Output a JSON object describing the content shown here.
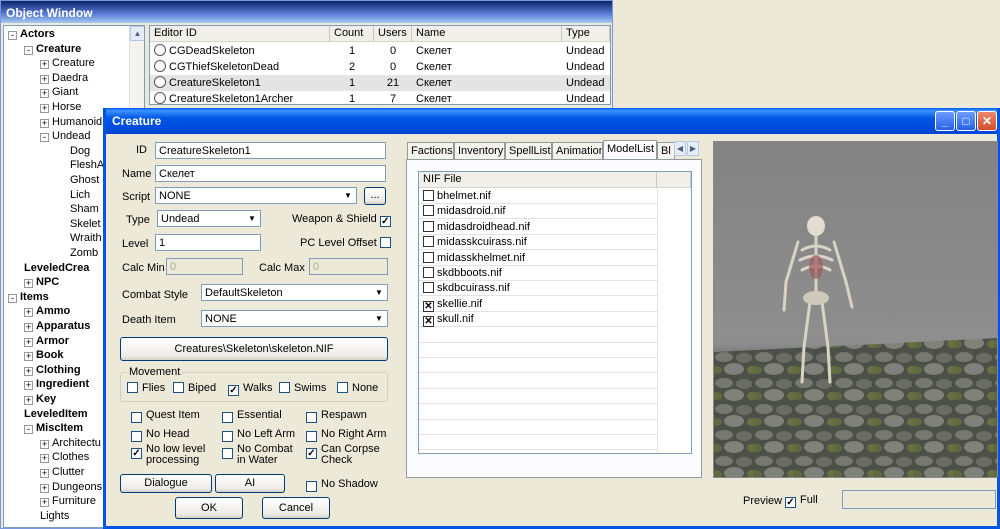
{
  "object_window": {
    "title": "Object Window",
    "tree": [
      {
        "label": "Actors",
        "level": 0,
        "bold": true,
        "box": "-"
      },
      {
        "label": "Creature",
        "level": 1,
        "bold": true,
        "box": "-"
      },
      {
        "label": "Creature",
        "level": 2,
        "bold": false,
        "box": "+"
      },
      {
        "label": "Daedra",
        "level": 2,
        "bold": false,
        "box": "+"
      },
      {
        "label": "Giant",
        "level": 2,
        "bold": false,
        "box": "+"
      },
      {
        "label": "Horse",
        "level": 2,
        "bold": false,
        "box": "+"
      },
      {
        "label": "Humanoid",
        "level": 2,
        "bold": false,
        "box": "+"
      },
      {
        "label": "Undead",
        "level": 2,
        "bold": false,
        "box": "-"
      },
      {
        "label": "Dog",
        "level": 3,
        "bold": false,
        "box": ""
      },
      {
        "label": "FleshA",
        "level": 3,
        "bold": false,
        "box": ""
      },
      {
        "label": "Ghost",
        "level": 3,
        "bold": false,
        "box": ""
      },
      {
        "label": "Lich",
        "level": 3,
        "bold": false,
        "box": ""
      },
      {
        "label": "Sham",
        "level": 3,
        "bold": false,
        "box": ""
      },
      {
        "label": "Skelet",
        "level": 3,
        "bold": false,
        "box": ""
      },
      {
        "label": "Wraith",
        "level": 3,
        "bold": false,
        "box": ""
      },
      {
        "label": "Zomb",
        "level": 3,
        "bold": false,
        "box": ""
      },
      {
        "label": "LeveledCrea",
        "level": 1,
        "bold": true,
        "box": ""
      },
      {
        "label": "NPC",
        "level": 1,
        "bold": true,
        "box": "+"
      },
      {
        "label": "Items",
        "level": 0,
        "bold": true,
        "box": "-"
      },
      {
        "label": "Ammo",
        "level": 1,
        "bold": true,
        "box": "+"
      },
      {
        "label": "Apparatus",
        "level": 1,
        "bold": true,
        "box": "+"
      },
      {
        "label": "Armor",
        "level": 1,
        "bold": true,
        "box": "+"
      },
      {
        "label": "Book",
        "level": 1,
        "bold": true,
        "box": "+"
      },
      {
        "label": "Clothing",
        "level": 1,
        "bold": true,
        "box": "+"
      },
      {
        "label": "Ingredient",
        "level": 1,
        "bold": true,
        "box": "+"
      },
      {
        "label": "Key",
        "level": 1,
        "bold": true,
        "box": "+"
      },
      {
        "label": "LeveledItem",
        "level": 1,
        "bold": true,
        "box": ""
      },
      {
        "label": "MiscItem",
        "level": 1,
        "bold": true,
        "box": "-"
      },
      {
        "label": "Architectu",
        "level": 2,
        "bold": false,
        "box": "+"
      },
      {
        "label": "Clothes",
        "level": 2,
        "bold": false,
        "box": "+"
      },
      {
        "label": "Clutter",
        "level": 2,
        "bold": false,
        "box": "+"
      },
      {
        "label": "Dungeons",
        "level": 2,
        "bold": false,
        "box": "+"
      },
      {
        "label": "Furniture",
        "level": 2,
        "bold": false,
        "box": "+"
      },
      {
        "label": "Lights",
        "level": 2,
        "bold": false,
        "box": ""
      }
    ],
    "columns": [
      "Editor ID",
      "Count",
      "Users",
      "Name",
      "Type"
    ],
    "rows": [
      {
        "id": "CGDeadSkeleton",
        "count": "1",
        "users": "0",
        "name": "Скелет",
        "type": "Undead"
      },
      {
        "id": "CGThiefSkeletonDead",
        "count": "2",
        "users": "0",
        "name": "Скелет",
        "type": "Undead"
      },
      {
        "id": "CreatureSkeleton1",
        "count": "1",
        "users": "21",
        "name": "Скелет",
        "type": "Undead"
      },
      {
        "id": "CreatureSkeleton1Archer",
        "count": "1",
        "users": "7",
        "name": "Скелет",
        "type": "Undead"
      }
    ]
  },
  "dialog": {
    "title": "Creature",
    "labels": {
      "id": "ID",
      "name": "Name",
      "script": "Script",
      "type": "Type",
      "level": "Level",
      "calc_min": "Calc Min",
      "calc_max": "Calc Max",
      "combat_style": "Combat Style",
      "death_item": "Death Item",
      "weapon_shield": "Weapon & Shield",
      "pc_level_offset": "PC Level Offset",
      "movement": "Movement",
      "preview": "Preview",
      "full": "Full"
    },
    "fields": {
      "id": "CreatureSkeleton1",
      "name": "Скелет",
      "script": "NONE",
      "script_btn": "...",
      "type": "Undead",
      "level": "1",
      "calc_min": "0",
      "calc_max": "0",
      "combat_style": "DefaultSkeleton",
      "death_item": "NONE"
    },
    "model_button": "Creatures\\Skeleton\\skeleton.NIF",
    "movement": [
      {
        "label": "Flies",
        "checked": false
      },
      {
        "label": "Biped",
        "checked": false
      },
      {
        "label": "Walks",
        "checked": true
      },
      {
        "label": "Swims",
        "checked": false
      },
      {
        "label": "None",
        "checked": false
      }
    ],
    "flags": [
      {
        "label": "Quest Item",
        "checked": false
      },
      {
        "label": "Essential",
        "checked": false
      },
      {
        "label": "Respawn",
        "checked": false
      },
      {
        "label": "No Head",
        "checked": false
      },
      {
        "label": "No Left Arm",
        "checked": false
      },
      {
        "label": "No Right Arm",
        "checked": false
      },
      {
        "label": "No low level processing",
        "line1": "No low level",
        "line2": "processing",
        "checked": true
      },
      {
        "label": "No Combat in Water",
        "line1": "No Combat",
        "line2": "in Water",
        "checked": false
      },
      {
        "label": "Can Corpse Check",
        "line1": "Can Corpse",
        "line2": "Check",
        "checked": true
      },
      {
        "label": "No Shadow",
        "checked": false
      }
    ],
    "buttons": {
      "dialogue": "Dialogue",
      "ai": "AI",
      "ok": "OK",
      "cancel": "Cancel"
    },
    "tabs": [
      "Factions",
      "Inventory",
      "SpellList",
      "Animation",
      "ModelList",
      "Bl"
    ],
    "active_tab": "ModelList",
    "nif_header": "NIF File",
    "nif_files": [
      {
        "file": "bhelmet.nif",
        "checked": false
      },
      {
        "file": "midasdroid.nif",
        "checked": false
      },
      {
        "file": "midasdroidhead.nif",
        "checked": false
      },
      {
        "file": "midasskcuirass.nif",
        "checked": false
      },
      {
        "file": "midasskhelmet.nif",
        "checked": false
      },
      {
        "file": "skdbboots.nif",
        "checked": false
      },
      {
        "file": "skdbcuirass.nif",
        "checked": false
      },
      {
        "file": "skellie.nif",
        "checked": true
      },
      {
        "file": "skull.nif",
        "checked": true
      }
    ],
    "weapon_shield_checked": true,
    "pc_level_offset_checked": false,
    "preview_full_checked": true
  }
}
